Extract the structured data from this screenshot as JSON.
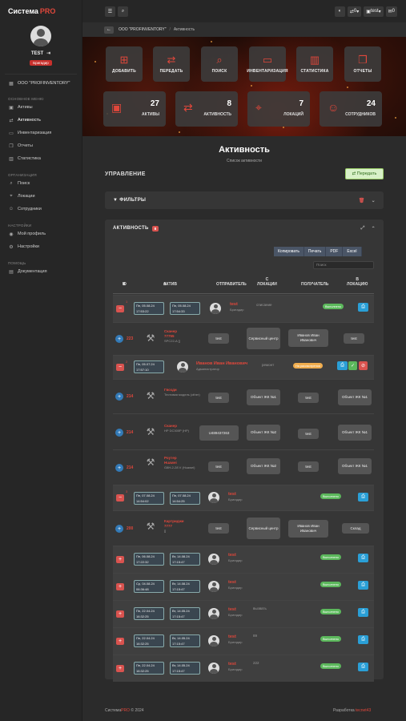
{
  "brand": {
    "name": "Система",
    "suffix": "PRO"
  },
  "user": {
    "name": "TEST",
    "role": "Бригадир"
  },
  "sidebar": {
    "org": "ООО \"PROFINVENTORY\"",
    "sections": [
      {
        "title": "ОСНОВНОЕ МЕНЮ",
        "items": [
          "Активы",
          "Активность",
          "Инвентаризация",
          "Отчеты",
          "Статистика"
        ]
      },
      {
        "title": "ОРГАНИЗАЦИЯ",
        "items": [
          "Поиск",
          "Локации",
          "Сотрудники"
        ]
      },
      {
        "title": "НАСТРОЙКИ",
        "items": [
          "Мой профиль",
          "Настройки"
        ]
      },
      {
        "title": "ПОМОЩЬ",
        "items": [
          "Документация"
        ]
      }
    ]
  },
  "topbar": {
    "menu_icon": "☰",
    "search_icon": "⌕",
    "theme_icon": "◐",
    "transfer_count": "0",
    "user": "test",
    "msg_count": "0"
  },
  "breadcrumb": {
    "org": "ООО \"PROFINVENTORY\"",
    "current": "Активность"
  },
  "quick_actions": [
    {
      "label": "ДОБАВИТЬ",
      "icon": "plus-square-icon"
    },
    {
      "label": "ПЕРЕДАТЬ",
      "icon": "exchange-icon"
    },
    {
      "label": "ПОИСК",
      "icon": "search-icon"
    },
    {
      "label": "ИНВЕНТАРИЗАЦИЯ",
      "icon": "laptop-icon"
    },
    {
      "label": "СТАТИСТИКА",
      "icon": "bar-chart-icon"
    },
    {
      "label": "ОТЧЕТЫ",
      "icon": "copy-icon"
    }
  ],
  "stats": [
    {
      "value": "27",
      "label": "АКТИВЫ"
    },
    {
      "value": "8",
      "label": "АКТИВНОСТЬ"
    },
    {
      "value": "7",
      "label": "ЛОКАЦИЙ"
    },
    {
      "value": "24",
      "label": "СОТРУДНИКОВ"
    }
  ],
  "page": {
    "title": "Активность",
    "subtitle": "Список активности",
    "management": "УПРАВЛЕНИЕ",
    "transfer_btn": "Передать"
  },
  "filters": {
    "title": "ФИЛЬТРЫ"
  },
  "activity": {
    "title": "АКТИВНОСТЬ",
    "count": "8"
  },
  "export": [
    "Копировать",
    "Печать",
    "PDF",
    "Excel"
  ],
  "search_placeholder": "Поиск",
  "table": {
    "headers": {
      "id": "ID",
      "asset": "АКТИВ",
      "sender": "ОТПРАВИТЕЛЬ",
      "from": "С ЛОКАЦИИ",
      "receiver": "ПОЛУЧАТЕЛЬ",
      "to": "В ЛОКАЦИЮ"
    }
  },
  "activity_rows": [
    {
      "d1": "Пн, 05.08.24",
      "t1": "17:53:22",
      "d2": "Пн, 05.08.24",
      "t2": "17:54:33",
      "name": "test",
      "role": "Бригадир",
      "note": "списание",
      "status": "Выполнено"
    },
    {
      "d1": "Пн, 05.07.24",
      "t1": "17:57:10",
      "name": "Иванов Иван Иванович",
      "role": "Администратор",
      "note": "ремонт",
      "status": "На рассмотрении"
    },
    {
      "d1": "Пн, 07.08.24",
      "t1": "14:54:02",
      "d2": "Пн, 07.08.24",
      "t2": "14:54:25",
      "name": "test",
      "role": "Бригадир",
      "note": "",
      "status": "Выполнено"
    },
    {
      "d1": "Пн, 06.08.24",
      "t1": "17:22:32",
      "d2": "Вт, 14.08.24",
      "t2": "17:15:47",
      "name": "test",
      "role": "Бригадир",
      "note": "",
      "status": "Выполнено"
    },
    {
      "d1": "Ср, 04.08.24",
      "t1": "06:36:48",
      "d2": "Вт, 14.08.24",
      "t2": "17:15:47",
      "name": "test",
      "role": "Бригадир",
      "note": "",
      "status": "Выполнено"
    },
    {
      "d1": "Пн, 22.04.24",
      "t1": "16:32:25",
      "d2": "Вт, 14.05.24",
      "t2": "17:15:47",
      "name": "test",
      "role": "Бригадир",
      "note": "вызвать",
      "status": "Выполнено"
    },
    {
      "d1": "Пн, 22.04.24",
      "t1": "16:32:25",
      "d2": "Вт, 14.05.24",
      "t2": "17:15:47",
      "name": "test",
      "role": "Бригадир",
      "note": "89",
      "status": "Выполнено"
    },
    {
      "d1": "Пн, 22.04.24",
      "t1": "16:32:25",
      "d2": "Вт, 14.05.24",
      "t2": "17:15:47",
      "name": "test",
      "role": "Бригадир",
      "note": "222",
      "status": "Выполнено"
    }
  ],
  "asset_rows": [
    {
      "id": "223",
      "asset": "Сканер",
      "model": "77755",
      "sub": "SPC22-A []",
      "sender": "test",
      "from": "Сервисный центр",
      "receiver": "Иванов Иван Иванович",
      "to": "test"
    },
    {
      "id": "214",
      "asset": "Гвозди",
      "model": "",
      "sub": "Тестовая модель (other)",
      "sender": "test",
      "from": "Объект ЖК №1",
      "receiver": "test",
      "to": "Объект ЖК №1"
    },
    {
      "id": "214",
      "asset": "Сканер",
      "model": "",
      "sub": "HP DC300P (HP)",
      "sender": "U489437263",
      "from": "Объект ЖК №2",
      "receiver": "test",
      "to": "Объект ЖК №1"
    },
    {
      "id": "214",
      "asset": "Роутер",
      "model": "Huawei",
      "sub": "G8H-2-28 V (Huawei)",
      "sender": "test",
      "from": "Объект ЖК №2",
      "receiver": "test",
      "to": "Объект ЖК №1"
    },
    {
      "id": "200",
      "asset": "Картриджи",
      "model": "7777",
      "sub": "[]",
      "sender": "test",
      "from": "Сервисный центр",
      "receiver": "Иванов Иван Иванович",
      "to": "Склад"
    }
  ],
  "footer": {
    "left_brand": "Система",
    "left_pro": "PRO",
    "left_year": "© 2024",
    "right_label": "Разработка",
    "right_brand": "tecnet43"
  },
  "colors": {
    "accent": "#e0473b",
    "success": "#5cb85c",
    "warning": "#f0ad4e",
    "info": "#2a9fd6"
  }
}
